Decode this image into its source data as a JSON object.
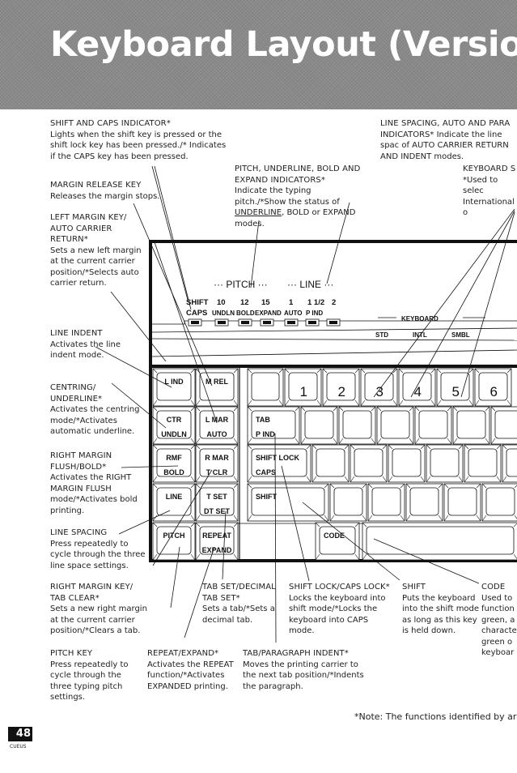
{
  "page": {
    "title": "Keyboard Layout (Version I)",
    "page_number": "48",
    "brand": "CUEUS",
    "footnote": "*Note: The functions identified by ar"
  },
  "annotations": {
    "shift_caps": {
      "title": "SHIFT AND CAPS INDICATOR*",
      "desc": "Lights when the shift key is pressed or the shift lock key has been pressed./* Indicates if the CAPS key has been pressed."
    },
    "margin_release": {
      "title": "MARGIN RELEASE KEY",
      "desc": "Releases the margin stops."
    },
    "left_margin": {
      "title": "LEFT MARGIN KEY/ AUTO CARRIER RETURN*",
      "desc": "Sets a new left margin at the current carrier position/*Selects auto carrier return."
    },
    "pitch_indicators": {
      "title": "PITCH, UNDERLINE, BOLD AND EXPAND INDICATORS*",
      "desc_a": "Indicate the typing pitch./*Show the status of ",
      "desc_u": "UNDERLINE",
      "desc_b": ", BOLD or EXPAND modes."
    },
    "line_spacing_ind": {
      "title": "LINE SPACING, AUTO AND PARA",
      "title2": "INDICATORS*",
      "desc": " Indicate the line spac of AUTO CARRIER RETURN AND INDENT modes."
    },
    "keyboard_select": {
      "title": "KEYBOARD S",
      "desc": "*Used to selec International o"
    },
    "line_indent": {
      "title": "LINE INDENT",
      "desc": "Activates the line indent mode."
    },
    "centring": {
      "title": "CENTRING/ UNDERLINE*",
      "desc": "Activates the centring mode/*Activates automatic underline."
    },
    "rmf": {
      "title": "RIGHT MARGIN FLUSH/BOLD*",
      "desc": "Activates the RIGHT MARGIN FLUSH mode/*Activates bold printing."
    },
    "line_spacing": {
      "title": "LINE SPACING",
      "desc": "Press repeatedly to cycle through the three line space settings."
    },
    "right_margin": {
      "title": "RIGHT MARGIN KEY/ TAB CLEAR*",
      "desc": "Sets a new right margin at the current carrier position/*Clears a tab."
    },
    "tab_set": {
      "title": "TAB SET/DECIMAL TAB SET*",
      "desc": "Sets a tab/*Sets a decimal tab."
    },
    "shift_lock": {
      "title": "SHIFT LOCK/CAPS LOCK*",
      "desc": "Locks the keyboard into shift mode/*Locks the keyboard into CAPS mode."
    },
    "shift": {
      "title": "SHIFT",
      "desc": "Puts the keyboard into the shift mode as long as this key is held down."
    },
    "code": {
      "title": "CODE",
      "desc": "Used to function green, a characte green o keyboar"
    },
    "pitch_key": {
      "title": "PITCH KEY",
      "desc": "Press repeatedly to cycle through the three typing pitch settings."
    },
    "repeat": {
      "title": "REPEAT/EXPAND*",
      "desc": "Activates the REPEAT function/*Activates EXPANDED printing."
    },
    "tab_para": {
      "title": "TAB/PARAGRAPH INDENT*",
      "desc": "Moves the printing carrier to the next tab position/*Indents the paragraph."
    }
  },
  "panel": {
    "pitch_label": "··· PITCH ···",
    "line_label": "··· LINE ···",
    "indicators": [
      {
        "top": "SHIFT",
        "bottom": "CAPS"
      },
      {
        "top": "10",
        "bottom": "UNDLN"
      },
      {
        "top": "12",
        "bottom": "BOLD"
      },
      {
        "top": "15",
        "bottom": "EXPAND"
      },
      {
        "top": "1",
        "bottom": "AUTO"
      },
      {
        "top": "1 1/2",
        "bottom": "P IND"
      },
      {
        "top": "2",
        "bottom": ""
      }
    ],
    "keyboard_label": "KEYBOARD",
    "keyboard_modes": [
      "STD",
      "INTL",
      "SMBL"
    ]
  },
  "keys": {
    "function": [
      {
        "l1": "L IND",
        "l2": ""
      },
      {
        "l1": "M REL",
        "l2": ""
      },
      {
        "l1": "CTR",
        "l2": "UNDLN"
      },
      {
        "l1": "L MAR",
        "l2": "AUTO"
      },
      {
        "l1": "RMF",
        "l2": "BOLD"
      },
      {
        "l1": "R MAR",
        "l2": "T CLR"
      },
      {
        "l1": "LINE",
        "l2": ""
      },
      {
        "l1": "T SET",
        "l2": "DT SET"
      },
      {
        "l1": "PITCH",
        "l2": ""
      },
      {
        "l1": "REPEAT",
        "l2": "EXPAND"
      }
    ],
    "tab": {
      "l1": "TAB",
      "l2": "P IND"
    },
    "shift_lock": {
      "l1": "SHIFT LOCK",
      "l2": "CAPS"
    },
    "shift": {
      "l1": "SHIFT"
    },
    "code": {
      "l1": "CODE"
    },
    "numbers": [
      "1",
      "2",
      "3",
      "4",
      "5",
      "6"
    ]
  }
}
